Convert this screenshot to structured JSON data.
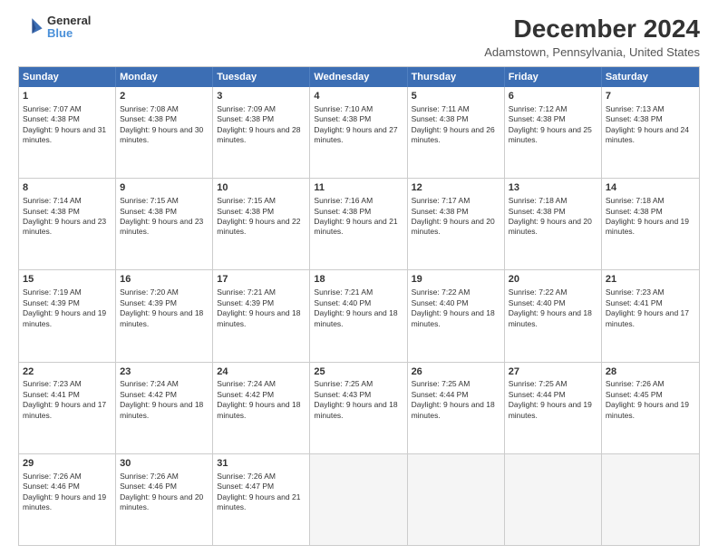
{
  "header": {
    "title": "December 2024",
    "subtitle": "Adamstown, Pennsylvania, United States",
    "logo_line1": "General",
    "logo_line2": "Blue"
  },
  "days_of_week": [
    "Sunday",
    "Monday",
    "Tuesday",
    "Wednesday",
    "Thursday",
    "Friday",
    "Saturday"
  ],
  "weeks": [
    [
      {
        "day": "1",
        "sunrise": "Sunrise: 7:07 AM",
        "sunset": "Sunset: 4:38 PM",
        "daylight": "Daylight: 9 hours and 31 minutes."
      },
      {
        "day": "2",
        "sunrise": "Sunrise: 7:08 AM",
        "sunset": "Sunset: 4:38 PM",
        "daylight": "Daylight: 9 hours and 30 minutes."
      },
      {
        "day": "3",
        "sunrise": "Sunrise: 7:09 AM",
        "sunset": "Sunset: 4:38 PM",
        "daylight": "Daylight: 9 hours and 28 minutes."
      },
      {
        "day": "4",
        "sunrise": "Sunrise: 7:10 AM",
        "sunset": "Sunset: 4:38 PM",
        "daylight": "Daylight: 9 hours and 27 minutes."
      },
      {
        "day": "5",
        "sunrise": "Sunrise: 7:11 AM",
        "sunset": "Sunset: 4:38 PM",
        "daylight": "Daylight: 9 hours and 26 minutes."
      },
      {
        "day": "6",
        "sunrise": "Sunrise: 7:12 AM",
        "sunset": "Sunset: 4:38 PM",
        "daylight": "Daylight: 9 hours and 25 minutes."
      },
      {
        "day": "7",
        "sunrise": "Sunrise: 7:13 AM",
        "sunset": "Sunset: 4:38 PM",
        "daylight": "Daylight: 9 hours and 24 minutes."
      }
    ],
    [
      {
        "day": "8",
        "sunrise": "Sunrise: 7:14 AM",
        "sunset": "Sunset: 4:38 PM",
        "daylight": "Daylight: 9 hours and 23 minutes."
      },
      {
        "day": "9",
        "sunrise": "Sunrise: 7:15 AM",
        "sunset": "Sunset: 4:38 PM",
        "daylight": "Daylight: 9 hours and 23 minutes."
      },
      {
        "day": "10",
        "sunrise": "Sunrise: 7:15 AM",
        "sunset": "Sunset: 4:38 PM",
        "daylight": "Daylight: 9 hours and 22 minutes."
      },
      {
        "day": "11",
        "sunrise": "Sunrise: 7:16 AM",
        "sunset": "Sunset: 4:38 PM",
        "daylight": "Daylight: 9 hours and 21 minutes."
      },
      {
        "day": "12",
        "sunrise": "Sunrise: 7:17 AM",
        "sunset": "Sunset: 4:38 PM",
        "daylight": "Daylight: 9 hours and 20 minutes."
      },
      {
        "day": "13",
        "sunrise": "Sunrise: 7:18 AM",
        "sunset": "Sunset: 4:38 PM",
        "daylight": "Daylight: 9 hours and 20 minutes."
      },
      {
        "day": "14",
        "sunrise": "Sunrise: 7:18 AM",
        "sunset": "Sunset: 4:38 PM",
        "daylight": "Daylight: 9 hours and 19 minutes."
      }
    ],
    [
      {
        "day": "15",
        "sunrise": "Sunrise: 7:19 AM",
        "sunset": "Sunset: 4:39 PM",
        "daylight": "Daylight: 9 hours and 19 minutes."
      },
      {
        "day": "16",
        "sunrise": "Sunrise: 7:20 AM",
        "sunset": "Sunset: 4:39 PM",
        "daylight": "Daylight: 9 hours and 18 minutes."
      },
      {
        "day": "17",
        "sunrise": "Sunrise: 7:21 AM",
        "sunset": "Sunset: 4:39 PM",
        "daylight": "Daylight: 9 hours and 18 minutes."
      },
      {
        "day": "18",
        "sunrise": "Sunrise: 7:21 AM",
        "sunset": "Sunset: 4:40 PM",
        "daylight": "Daylight: 9 hours and 18 minutes."
      },
      {
        "day": "19",
        "sunrise": "Sunrise: 7:22 AM",
        "sunset": "Sunset: 4:40 PM",
        "daylight": "Daylight: 9 hours and 18 minutes."
      },
      {
        "day": "20",
        "sunrise": "Sunrise: 7:22 AM",
        "sunset": "Sunset: 4:40 PM",
        "daylight": "Daylight: 9 hours and 18 minutes."
      },
      {
        "day": "21",
        "sunrise": "Sunrise: 7:23 AM",
        "sunset": "Sunset: 4:41 PM",
        "daylight": "Daylight: 9 hours and 17 minutes."
      }
    ],
    [
      {
        "day": "22",
        "sunrise": "Sunrise: 7:23 AM",
        "sunset": "Sunset: 4:41 PM",
        "daylight": "Daylight: 9 hours and 17 minutes."
      },
      {
        "day": "23",
        "sunrise": "Sunrise: 7:24 AM",
        "sunset": "Sunset: 4:42 PM",
        "daylight": "Daylight: 9 hours and 18 minutes."
      },
      {
        "day": "24",
        "sunrise": "Sunrise: 7:24 AM",
        "sunset": "Sunset: 4:42 PM",
        "daylight": "Daylight: 9 hours and 18 minutes."
      },
      {
        "day": "25",
        "sunrise": "Sunrise: 7:25 AM",
        "sunset": "Sunset: 4:43 PM",
        "daylight": "Daylight: 9 hours and 18 minutes."
      },
      {
        "day": "26",
        "sunrise": "Sunrise: 7:25 AM",
        "sunset": "Sunset: 4:44 PM",
        "daylight": "Daylight: 9 hours and 18 minutes."
      },
      {
        "day": "27",
        "sunrise": "Sunrise: 7:25 AM",
        "sunset": "Sunset: 4:44 PM",
        "daylight": "Daylight: 9 hours and 19 minutes."
      },
      {
        "day": "28",
        "sunrise": "Sunrise: 7:26 AM",
        "sunset": "Sunset: 4:45 PM",
        "daylight": "Daylight: 9 hours and 19 minutes."
      }
    ],
    [
      {
        "day": "29",
        "sunrise": "Sunrise: 7:26 AM",
        "sunset": "Sunset: 4:46 PM",
        "daylight": "Daylight: 9 hours and 19 minutes."
      },
      {
        "day": "30",
        "sunrise": "Sunrise: 7:26 AM",
        "sunset": "Sunset: 4:46 PM",
        "daylight": "Daylight: 9 hours and 20 minutes."
      },
      {
        "day": "31",
        "sunrise": "Sunrise: 7:26 AM",
        "sunset": "Sunset: 4:47 PM",
        "daylight": "Daylight: 9 hours and 21 minutes."
      },
      null,
      null,
      null,
      null
    ]
  ]
}
